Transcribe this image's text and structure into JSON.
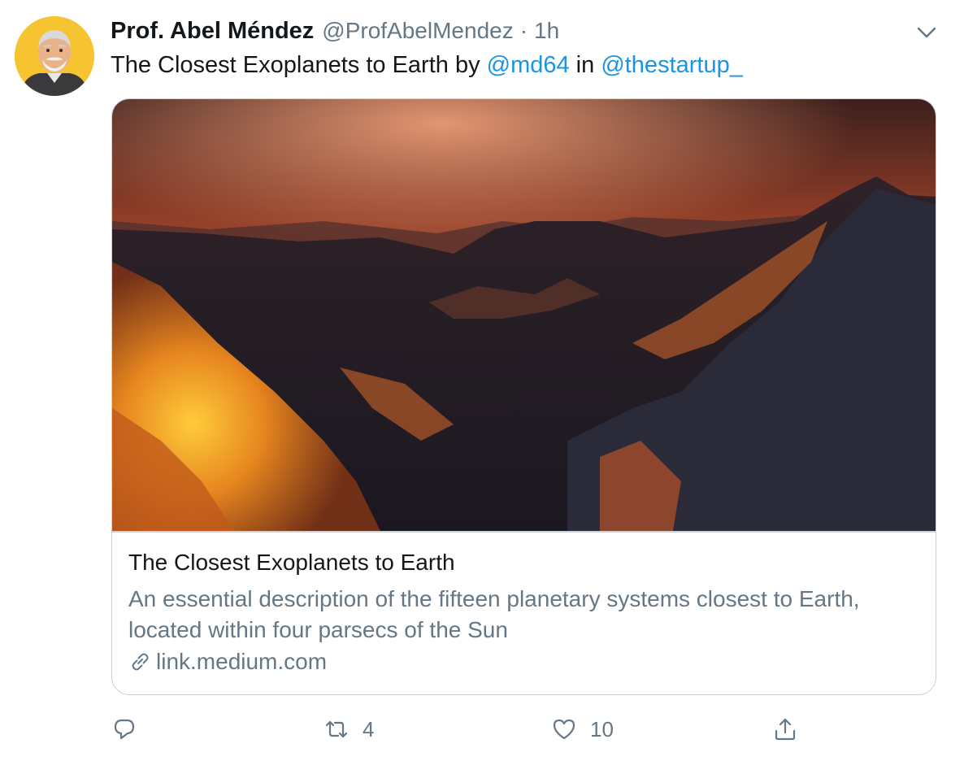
{
  "tweet": {
    "author_name": "Prof. Abel Méndez",
    "author_handle": "@ProfAbelMendez",
    "separator": "·",
    "time": "1h",
    "text_parts": {
      "t1": "The Closest Exoplanets to Earth by ",
      "mention1": "@md64",
      "t2": " in ",
      "mention2": "@thestartup_"
    }
  },
  "card": {
    "title": "The Closest Exoplanets to Earth",
    "description": "An essential description of the fifteen planetary systems closest to Earth, located within four parsecs of the Sun",
    "domain": "link.medium.com"
  },
  "actions": {
    "reply_count": "",
    "retweet_count": "4",
    "like_count": "10"
  },
  "colors": {
    "link": "#1b95e0",
    "secondary_text": "#657786",
    "border": "#c7d2da",
    "avatar_bg": "#f6c431"
  },
  "icons": {
    "more": "chevron-down-icon",
    "reply": "reply-icon",
    "retweet": "retweet-icon",
    "like": "heart-icon",
    "share": "share-icon",
    "link": "link-icon"
  }
}
